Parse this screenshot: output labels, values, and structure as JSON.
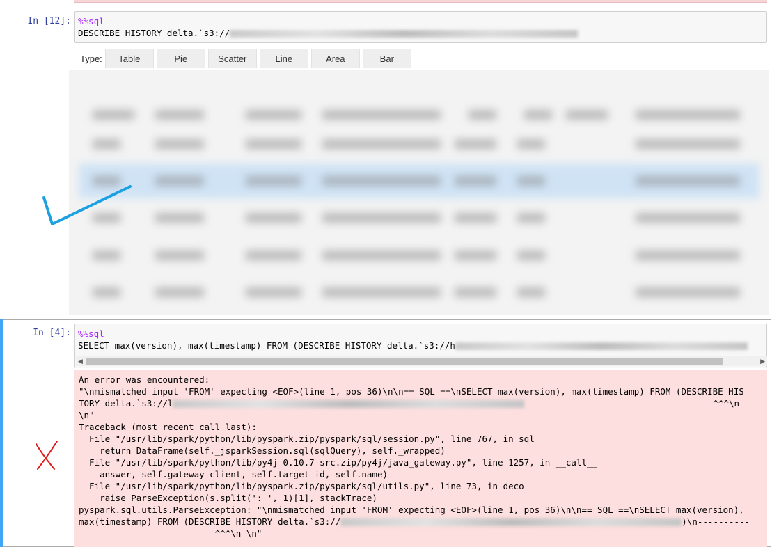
{
  "cell12": {
    "prompt": "In [12]:",
    "magic": "%%sql",
    "code_line": "DESCRIBE HISTORY delta.`s3://"
  },
  "chart_types": {
    "label": "Type:",
    "buttons": [
      "Table",
      "Pie",
      "Scatter",
      "Line",
      "Area",
      "Bar"
    ]
  },
  "cell4": {
    "prompt": "In [4]:",
    "magic": "%%sql",
    "code_line": "SELECT max(version), max(timestamp) FROM (DESCRIBE HISTORY delta.`s3://h",
    "error_lines": [
      "An error was encountered:",
      "\"\\nmismatched input 'FROM' expecting <EOF>(line 1, pos 36)\\n\\n== SQL ==\\nSELECT max(version), max(timestamp) FROM (DESCRIBE HIS",
      "TORY delta.`s3://l",
      "\\n\"",
      "Traceback (most recent call last):",
      "  File \"/usr/lib/spark/python/lib/pyspark.zip/pyspark/sql/session.py\", line 767, in sql",
      "    return DataFrame(self._jsparkSession.sql(sqlQuery), self._wrapped)",
      "  File \"/usr/lib/spark/python/lib/py4j-0.10.7-src.zip/py4j/java_gateway.py\", line 1257, in __call__",
      "    answer, self.gateway_client, self.target_id, self.name)",
      "  File \"/usr/lib/spark/python/lib/pyspark.zip/pyspark/sql/utils.py\", line 73, in deco",
      "    raise ParseException(s.split(': ', 1)[1], stackTrace)",
      "pyspark.sql.utils.ParseException: \"\\nmismatched input 'FROM' expecting <EOF>(line 1, pos 36)\\n\\n== SQL ==\\nSELECT max(version),",
      "max(timestamp) FROM (DESCRIBE HISTORY delta.`s3://",
      "--------------------------^^^\\n \\n\""
    ],
    "error_line3_tail": "------------------------------------^^^\\n",
    "error_line13_tail": ")\\n----------"
  },
  "colors": {
    "prompt": "#303f9f",
    "magic": "#aa22ff",
    "error_bg": "#fddfdf",
    "active_cell": "#42a5f5",
    "checkmark": "#1ba1e2",
    "xmark": "#e01a1a"
  }
}
